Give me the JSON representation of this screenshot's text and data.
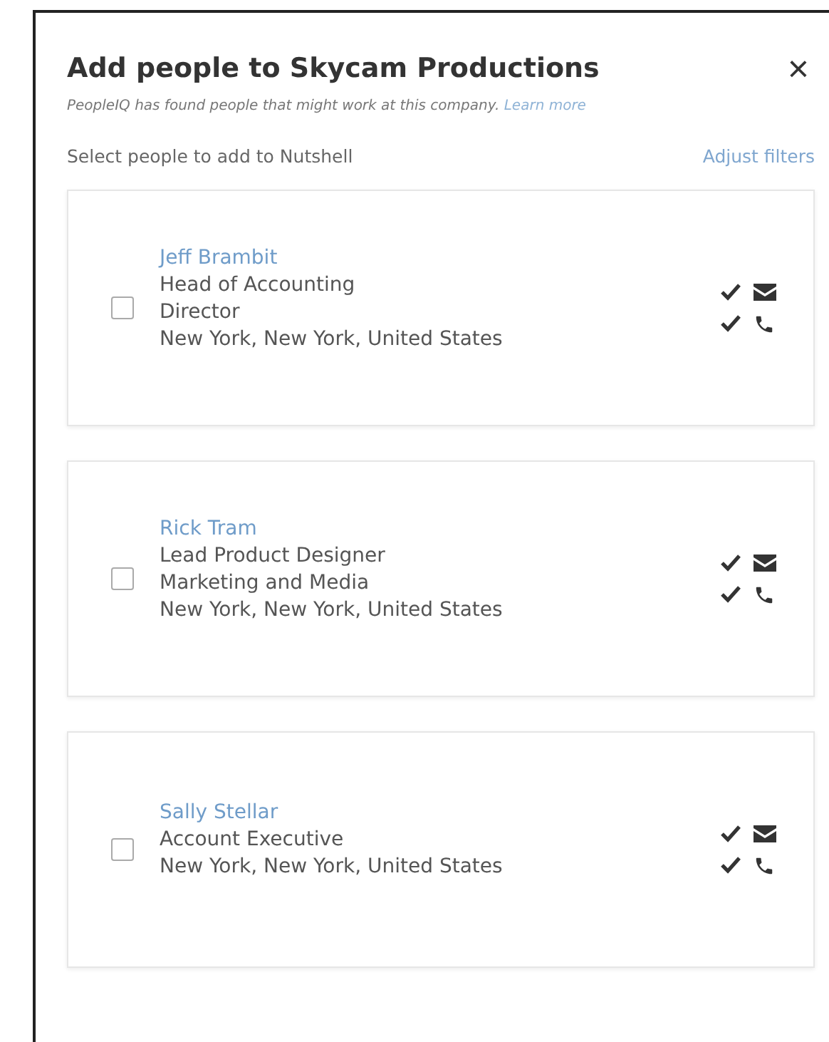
{
  "dialog": {
    "title": "Add people to Skycam Productions",
    "close": "×",
    "notice": "PeopleIQ has found people that might work at this company.",
    "learn_more": "Learn more",
    "prompt": "Select people to add to Nutshell",
    "adjust_filters": "Adjust filters"
  },
  "people": [
    {
      "name": "Jeff Brambit",
      "details": [
        "Head of Accounting",
        "Director",
        "New York, New York, United States"
      ],
      "checked": false,
      "email_verified": true,
      "phone_verified": true
    },
    {
      "name": "Rick Tram",
      "details": [
        "Lead Product Designer",
        "Marketing and Media",
        "New York, New York, United States"
      ],
      "checked": false,
      "email_verified": true,
      "phone_verified": true
    },
    {
      "name": "Sally Stellar",
      "details": [
        "Account Executive",
        "New York, New York, United States"
      ],
      "checked": false,
      "email_verified": true,
      "phone_verified": true
    }
  ]
}
